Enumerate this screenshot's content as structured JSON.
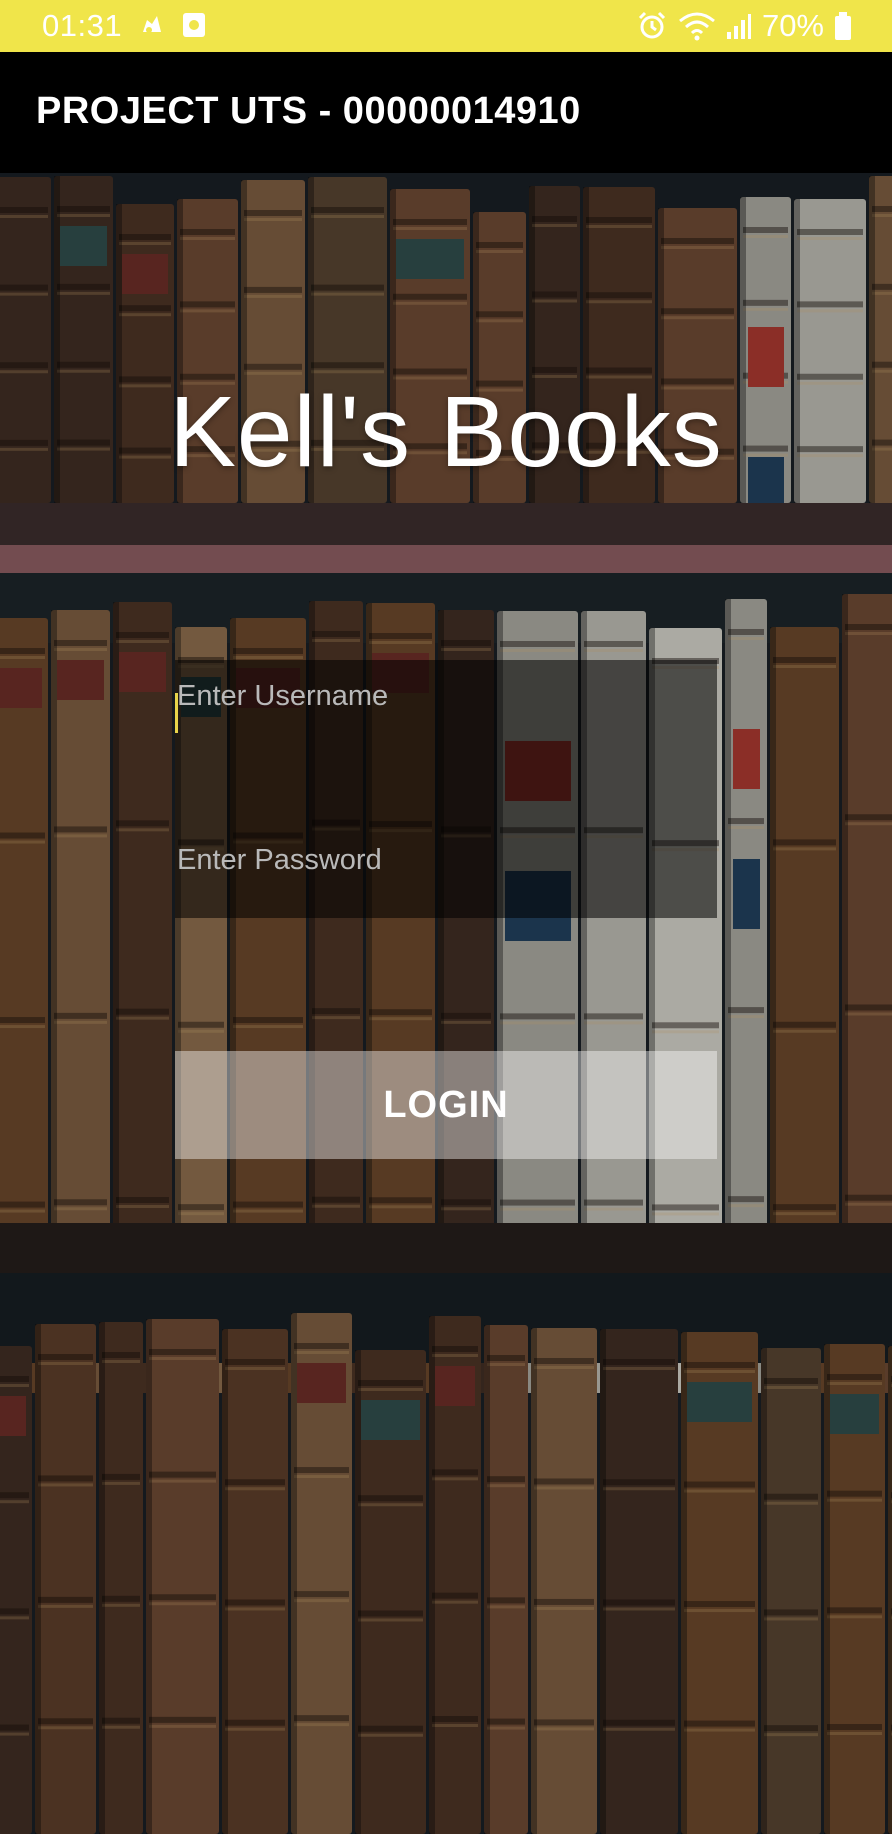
{
  "status_bar": {
    "time": "01:31",
    "battery_percent": "70%",
    "left_icons": [
      "notification-icon",
      "screenshot-icon"
    ],
    "right_icons": [
      "alarm-icon",
      "wifi-icon",
      "signal-icon",
      "battery-icon"
    ]
  },
  "app_bar": {
    "title": "PROJECT UTS - 00000014910"
  },
  "login": {
    "brand": "Kell's Books",
    "username_placeholder": "Enter Username",
    "password_placeholder": "Enter Password",
    "login_label": "LOGIN"
  },
  "colors": {
    "status_bar": "#f0e54a",
    "app_bar": "#000000",
    "caret": "#e8d44a"
  }
}
